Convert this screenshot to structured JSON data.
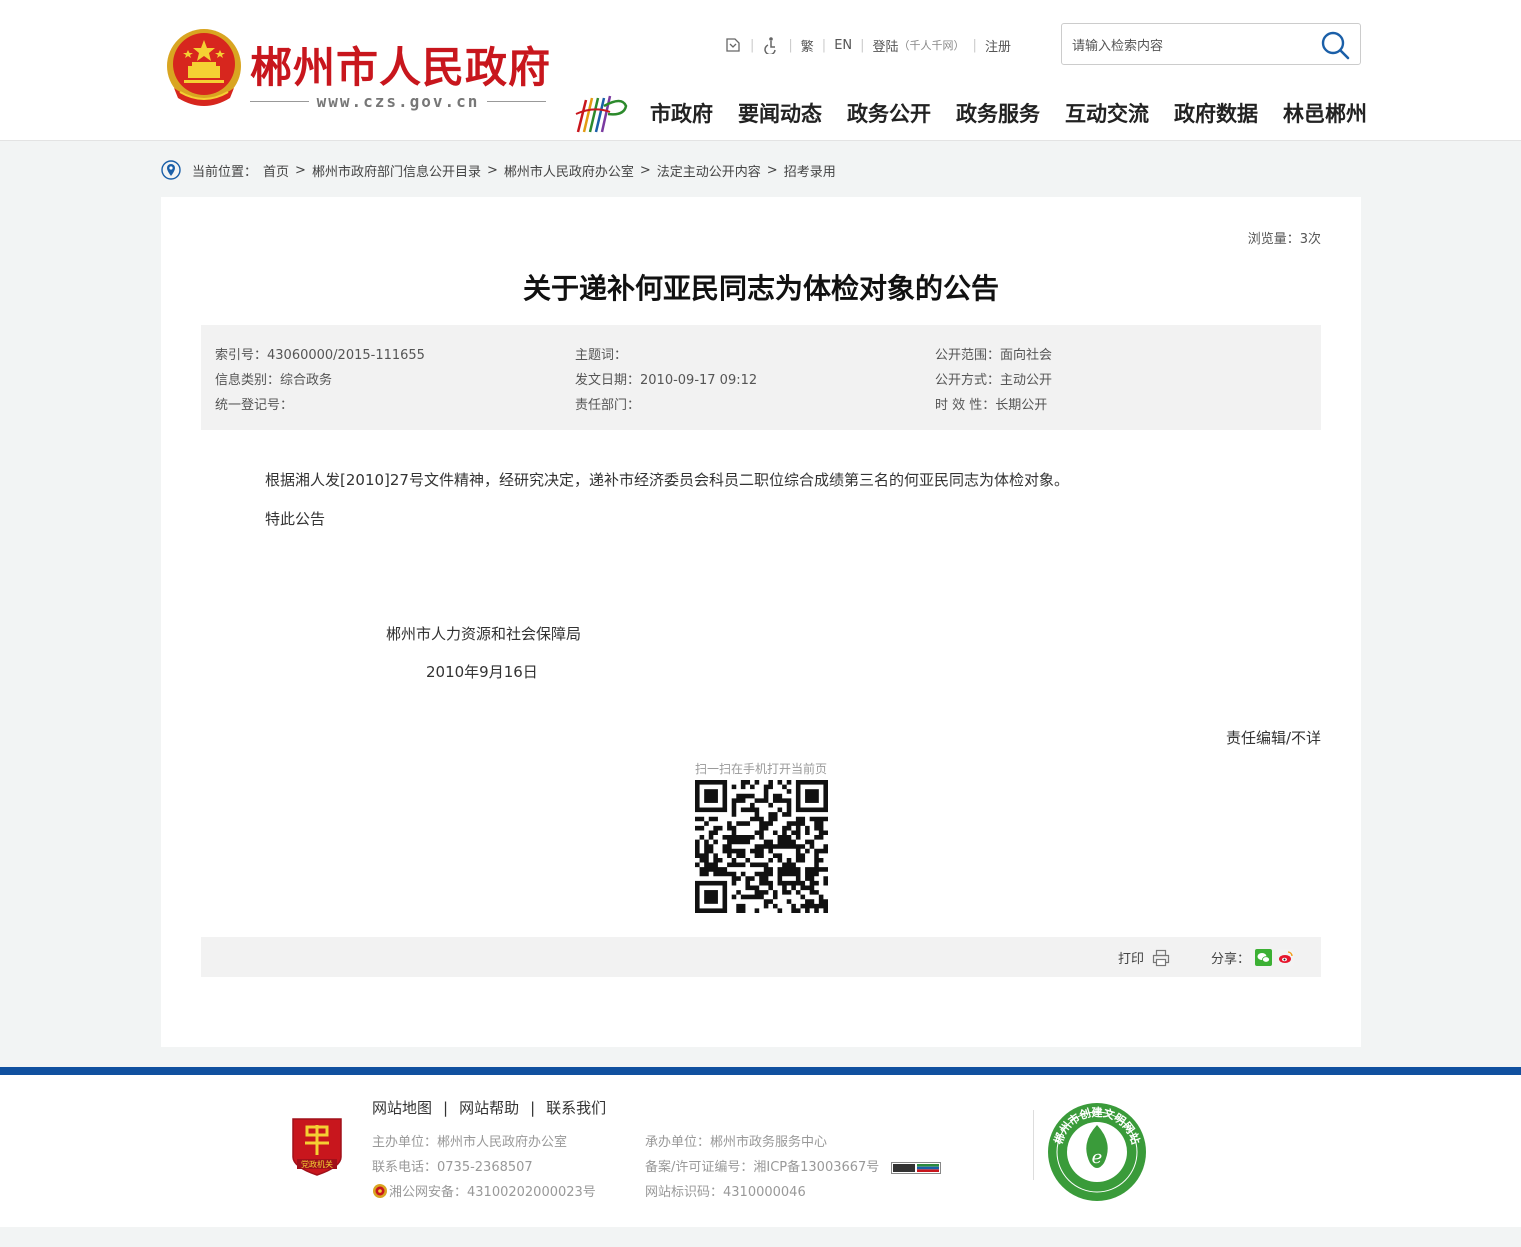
{
  "header": {
    "site_name": "郴州市人民政府",
    "site_domain": "www.czs.gov.cn",
    "toplinks": {
      "traditional": "繁",
      "english": "EN",
      "login": "登陆",
      "login_note": "（千人千网）",
      "register": "注册"
    },
    "search": {
      "placeholder": "请输入检索内容"
    },
    "nav": [
      "市政府",
      "要闻动态",
      "政务公开",
      "政务服务",
      "互动交流",
      "政府数据",
      "林邑郴州"
    ]
  },
  "breadcrumb": {
    "label": "当前位置：",
    "items": [
      "首页",
      "郴州市政府部门信息公开目录",
      "郴州市人民政府办公室",
      "法定主动公开内容",
      "招考录用"
    ]
  },
  "article": {
    "views": "浏览量：3次",
    "title": "关于递补何亚民同志为体检对象的公告",
    "meta": {
      "index_no": "索引号：43060000/2015-111655",
      "subject": "主题词：",
      "scope": "公开范围：面向社会",
      "category": "信息类别：综合政务",
      "date": "发文日期：2010-09-17 09:12",
      "method": "公开方式：主动公开",
      "reg_no": "统一登记号：",
      "department": "责任部门：",
      "validity": "时 效 性：长期公开"
    },
    "body": "根据湘人发[2010]27号文件精神，经研究决定，递补市经济委员会科员二职位综合成绩第三名的何亚民同志为体检对象。",
    "closing": "特此公告",
    "sign_org": "郴州市人力资源和社会保障局",
    "sign_date": "2010年9月16日",
    "editor": "责任编辑/不详",
    "qr_caption": "扫一扫在手机打开当前页",
    "print_label": "打印",
    "share_label": "分享："
  },
  "footer": {
    "links": [
      "网站地图",
      "网站帮助",
      "联系我们"
    ],
    "host": "主办单位：郴州市人民政府办公室",
    "phone": "联系电话：0735-2368507",
    "police": "湘公网安备：43100202000023号",
    "undertaker": "承办单位：郴州市政务服务中心",
    "icp": "备案/许可证编号：湘ICP备13003667号",
    "site_id": "网站标识码：4310000046",
    "dang_label": "党政机关",
    "wenming_text": "郴州市创建文明网站"
  },
  "colors": {
    "brand_red": "#c8161d",
    "footer_blue": "#10509f",
    "breadcrumb_pin": "#1a5fa8"
  }
}
